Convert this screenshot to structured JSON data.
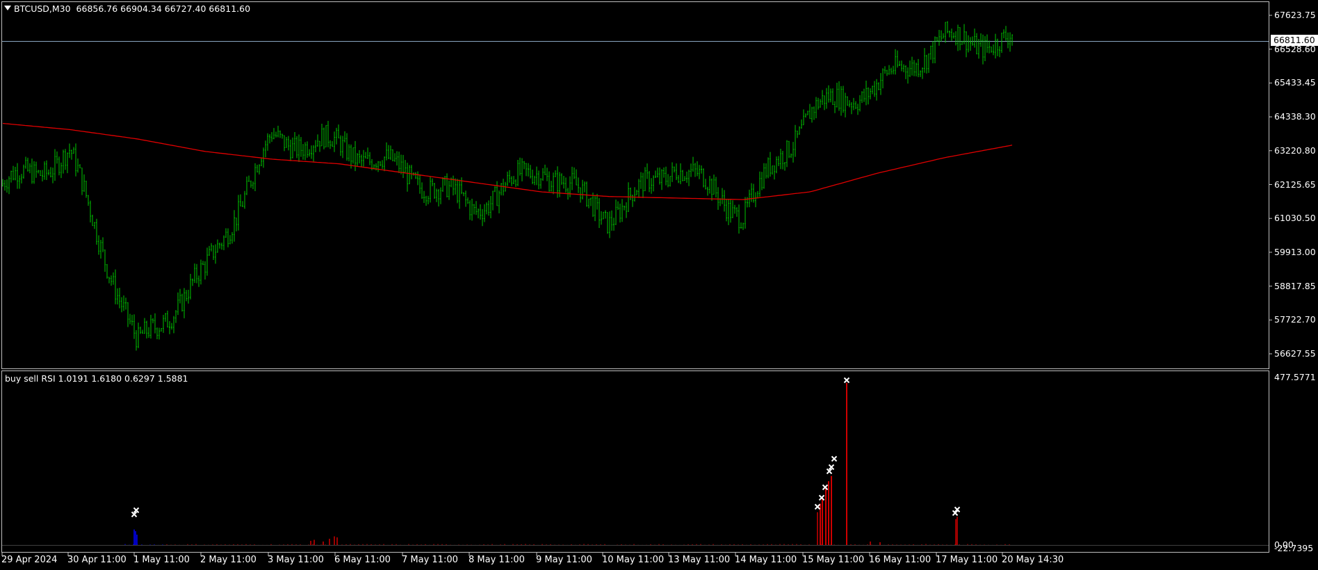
{
  "main_chart": {
    "symbol_timeframe": "BTCUSD,M30",
    "ohlc": "66856.76 66904.34 66727.40 66811.60",
    "current_price_label": "66811.60",
    "y_ticks": [
      "67623.75",
      "66528.60",
      "65433.45",
      "64338.30",
      "63220.80",
      "62125.65",
      "61030.50",
      "59913.00",
      "58817.85",
      "57722.70",
      "56627.55"
    ],
    "colors": {
      "candles": "#00c800",
      "moving_average": "#e00000",
      "price_line": "#8aa6c1",
      "background": "#000000",
      "border": "#c0c0c0"
    }
  },
  "indicator": {
    "title": "buy sell RSI 1.0191 1.6180 0.6297 1.5881",
    "y_max_label": "477.5771",
    "y_zero_label": "0.00",
    "y_min_label": "-22.7395",
    "colors": {
      "buy": "#0000ff",
      "sell": "#d00000",
      "markers": "#ffffff"
    }
  },
  "x_axis": {
    "labels": [
      "29 Apr 2024",
      "30 Apr 11:00",
      "1 May 11:00",
      "2 May 11:00",
      "3 May 11:00",
      "6 May 11:00",
      "7 May 11:00",
      "8 May 11:00",
      "9 May 11:00",
      "10 May 11:00",
      "13 May 11:00",
      "14 May 11:00",
      "15 May 11:00",
      "16 May 11:00",
      "17 May 11:00",
      "20 May 14:30"
    ]
  },
  "chart_data": {
    "type": "line",
    "title": "BTCUSD,M30",
    "xlabel": "",
    "ylabel": "",
    "ylim": [
      56300,
      68100
    ],
    "series": [
      {
        "name": "",
        "x": [
          "29 Apr 2024",
          "30 Apr 11:00",
          "1 May 11:00",
          "2 May 11:00",
          "3 May 11:00",
          "6 May 11:00",
          "7 May 11:00",
          "8 May 11:00",
          "9 May 11:00",
          "10 May 11:00",
          "13 May 11:00",
          "14 May 11:00",
          "15 May 11:00",
          "16 May 11:00",
          "17 May 11:00",
          "20 May 14:30"
        ],
        "values": [
          62200,
          63200,
          57000,
          59400,
          63700,
          63500,
          62600,
          61500,
          62800,
          61200,
          62900,
          61300,
          64600,
          65400,
          66900,
          66811.6
        ]
      },
      {
        "name": "",
        "x": [
          "29 Apr 2024",
          "30 Apr 11:00",
          "1 May 11:00",
          "2 May 11:00",
          "3 May 11:00",
          "6 May 11:00",
          "7 May 11:00",
          "8 May 11:00",
          "9 May 11:00",
          "10 May 11:00",
          "13 May 11:00",
          "14 May 11:00",
          "15 May 11:00",
          "16 May 11:00",
          "17 May 11:00",
          "20 May 14:30"
        ],
        "values": [
          64200,
          64000,
          63700,
          63300,
          63050,
          62900,
          62600,
          62300,
          62000,
          61850,
          61800,
          61750,
          62000,
          62600,
          63100,
          63500
        ]
      }
    ]
  }
}
